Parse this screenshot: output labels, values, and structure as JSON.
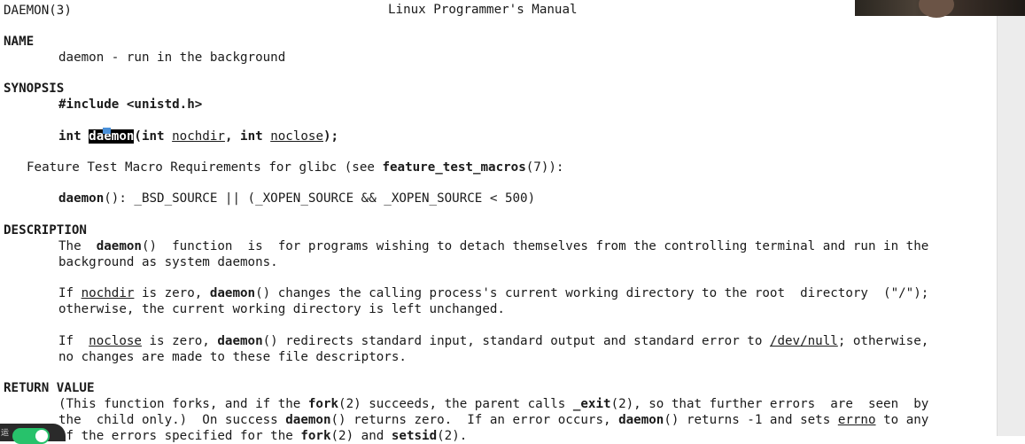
{
  "header": {
    "left": "DAEMON(3)",
    "center": "Linux Programmer's Manual"
  },
  "name": {
    "heading": "NAME",
    "text": "daemon - run in the background"
  },
  "synopsis": {
    "heading": "SYNOPSIS",
    "include": "#include <unistd.h>",
    "sig_int": "int",
    "sig_func": "daemon",
    "sig_open": "(",
    "sig_int2": "int",
    "sig_arg1": "nochdir",
    "sig_comma": ",",
    "sig_int3": "int",
    "sig_arg2": "noclose",
    "sig_close": ");",
    "ftm_prefix": "Feature Test Macro Requirements for glibc (see ",
    "ftm_link": "feature_test_macros",
    "ftm_suffix": "(7)):",
    "macro_func": "daemon",
    "macro_rest": "(): _BSD_SOURCE || (_XOPEN_SOURCE && _XOPEN_SOURCE < 500)"
  },
  "description": {
    "heading": "DESCRIPTION",
    "p1_a": "The  ",
    "p1_b": "daemon",
    "p1_c": "()  function  is  for programs wishing to detach themselves from the controlling terminal and run in the",
    "p1_line2": "background as system daemons.",
    "p2_a": "If ",
    "p2_b": "nochdir",
    "p2_c": " is zero, ",
    "p2_d": "daemon",
    "p2_e": "() changes the calling process's current working directory to the root  directory  (\"/\");",
    "p2_line2": "otherwise, the current working directory is left unchanged.",
    "p3_a": "If  ",
    "p3_b": "noclose",
    "p3_c": " is zero, ",
    "p3_d": "daemon",
    "p3_e": "() redirects standard input, standard output and standard error to ",
    "p3_f": "/dev/null",
    "p3_g": "; otherwise,",
    "p3_line2": "no changes are made to these file descriptors."
  },
  "return_value": {
    "heading": "RETURN VALUE",
    "l1_a": "(This function forks, and if the ",
    "l1_b": "fork",
    "l1_c": "(2) succeeds, the parent calls ",
    "l1_d": "_exit",
    "l1_e": "(2), so that further errors  are  seen  by",
    "l2_a": "the  child only.)  On success ",
    "l2_b": "daemon",
    "l2_c": "() returns zero.  If an error occurs, ",
    "l2_d": "daemon",
    "l2_e": "() returns -1 and sets ",
    "l2_f": "errno",
    "l2_g": " to any",
    "l3_a": "of the errors specified for the ",
    "l3_b": "fork",
    "l3_c": "(2) and ",
    "l3_d": "setsid",
    "l3_e": "(2)."
  },
  "overlay": {
    "toggle_label": "运"
  },
  "colors": {
    "background": "#ffffff",
    "text": "#1a1a1a",
    "toggle": "#27c26b",
    "cursor": "#4a90d9"
  }
}
